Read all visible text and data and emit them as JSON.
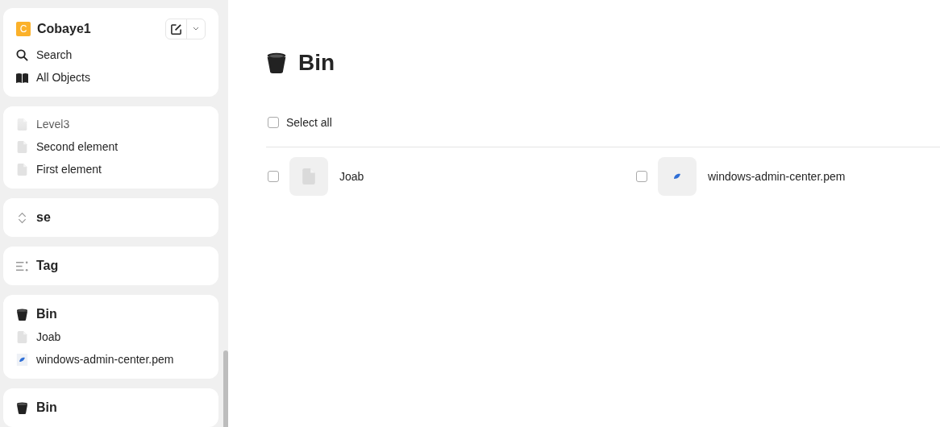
{
  "sidebar": {
    "space": {
      "initial": "C",
      "name": "Cobaye1",
      "links": [
        {
          "kind": "search",
          "label": "Search"
        },
        {
          "kind": "book",
          "label": "All Objects"
        }
      ]
    },
    "widgets": [
      {
        "kind": "tree",
        "items": [
          {
            "kind": "doc",
            "label": "Level3"
          },
          {
            "kind": "doc",
            "label": "Second element"
          },
          {
            "kind": "doc",
            "label": "First element"
          }
        ]
      },
      {
        "kind": "chevrons",
        "title": "se"
      },
      {
        "kind": "tag",
        "title": "Tag"
      },
      {
        "kind": "bin",
        "title": "Bin",
        "items": [
          {
            "kind": "doc",
            "label": "Joab"
          },
          {
            "kind": "pem",
            "label": "windows-admin-center.pem"
          }
        ]
      },
      {
        "kind": "bin",
        "title": "Bin"
      }
    ]
  },
  "main": {
    "title": "Bin",
    "select_all": {
      "label": "Select all",
      "checked": false
    },
    "items": [
      {
        "kind": "doc",
        "label": "Joab",
        "checked": false
      },
      {
        "kind": "pem",
        "label": "windows-admin-center.pem",
        "checked": false
      }
    ]
  }
}
